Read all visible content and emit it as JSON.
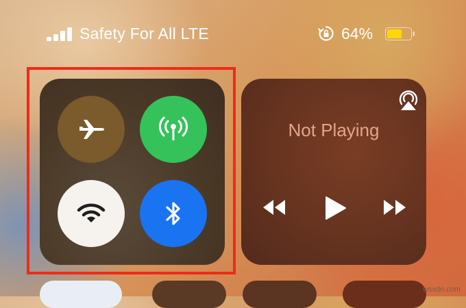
{
  "status_bar": {
    "carrier": "Safety For All LTE",
    "signal_bars": 4,
    "battery_percent": "64%",
    "battery_level": 0.64,
    "icons": [
      "signal-bars-icon",
      "rotation-lock-icon",
      "battery-icon"
    ]
  },
  "connectivity": {
    "buttons": [
      {
        "name": "airplane-mode",
        "icon": "airplane-icon",
        "state": "off",
        "color": "#7b5a2b"
      },
      {
        "name": "cellular-data",
        "icon": "antenna-icon",
        "state": "on",
        "color": "#35c25a"
      },
      {
        "name": "wifi",
        "icon": "wifi-icon",
        "state": "on",
        "color": "#f6f2ee"
      },
      {
        "name": "bluetooth",
        "icon": "bluetooth-icon",
        "state": "on",
        "color": "#1a73f0"
      }
    ],
    "highlight_color": "#f02a19"
  },
  "media": {
    "title": "Not Playing",
    "icons": [
      "airplay-icon",
      "rewind-icon",
      "play-icon",
      "fast-forward-icon"
    ]
  },
  "watermark": "wsxdn.com"
}
